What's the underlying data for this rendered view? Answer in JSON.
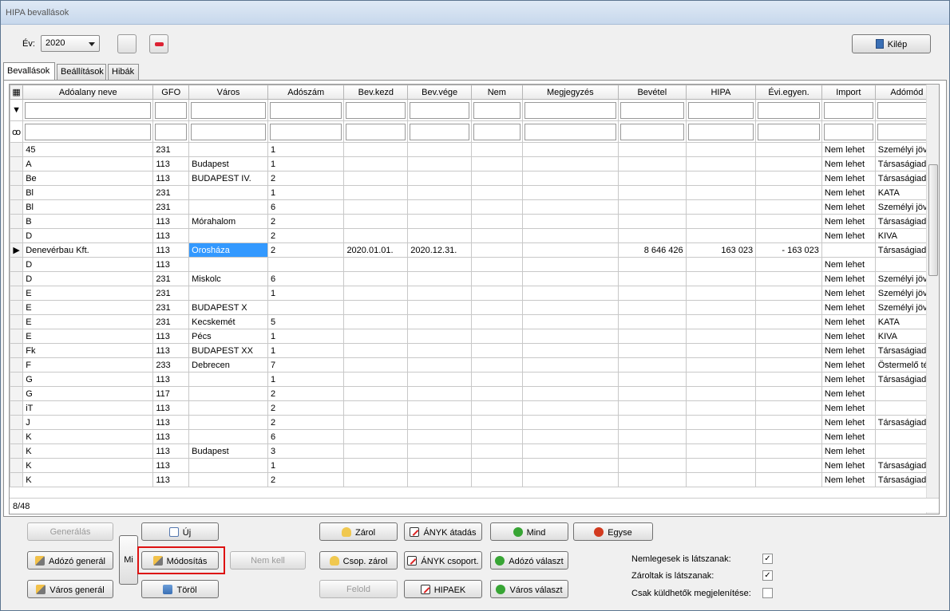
{
  "window": {
    "title": "HIPA bevallások"
  },
  "toolbar": {
    "year_label": "Év:",
    "year_value": "2020",
    "exit_label": "Kilép"
  },
  "tabs": [
    "Bevallások",
    "Beállítások",
    "Hibák"
  ],
  "grid": {
    "columns": [
      "Adóalany neve",
      "GFO",
      "Város",
      "Adószám",
      "Bev.kezd",
      "Bev.vége",
      "Nem",
      "Megjegyzés",
      "Bevétel",
      "HIPA",
      "Évi.egyen.",
      "Import",
      "Adómód"
    ],
    "rows": [
      [
        "45",
        "231",
        "",
        "1",
        "",
        "",
        "",
        "",
        "",
        "",
        "",
        "Nem lehet",
        "Személyi jöve"
      ],
      [
        "A",
        "113",
        "Budapest",
        "1",
        "",
        "",
        "",
        "",
        "",
        "",
        "",
        "Nem lehet",
        "Társaságiadó"
      ],
      [
        "Be",
        "113",
        "BUDAPEST IV.",
        "2",
        "",
        "",
        "",
        "",
        "",
        "",
        "",
        "Nem lehet",
        "Társaságiadó"
      ],
      [
        "Bl",
        "231",
        "",
        "1",
        "",
        "",
        "",
        "",
        "",
        "",
        "",
        "Nem lehet",
        "KATA"
      ],
      [
        "Bl",
        "231",
        "",
        "6",
        "",
        "",
        "",
        "",
        "",
        "",
        "",
        "Nem lehet",
        "Személyi jöve"
      ],
      [
        "B",
        "113",
        "Mórahalom",
        "2",
        "",
        "",
        "",
        "",
        "",
        "",
        "",
        "Nem lehet",
        "Társaságiadó"
      ],
      [
        "D",
        "113",
        "",
        "2",
        "",
        "",
        "",
        "",
        "",
        "",
        "",
        "Nem lehet",
        "KIVA"
      ],
      [
        "Denevérbau Kft.",
        "113",
        "Orosháza",
        "2",
        "2020.01.01.",
        "2020.12.31.",
        "",
        "",
        "8 646 426",
        "163 023",
        "- 163 023",
        "",
        "Társaságiadó"
      ],
      [
        "D",
        "113",
        "",
        "",
        "",
        "",
        "",
        "",
        "",
        "",
        "",
        "Nem lehet",
        ""
      ],
      [
        "D",
        "231",
        "Miskolc",
        "6",
        "",
        "",
        "",
        "",
        "",
        "",
        "",
        "Nem lehet",
        "Személyi jöve"
      ],
      [
        "E",
        "231",
        "",
        "1",
        "",
        "",
        "",
        "",
        "",
        "",
        "",
        "Nem lehet",
        "Személyi jöve"
      ],
      [
        "E",
        "231",
        "BUDAPEST X",
        "",
        "",
        "",
        "",
        "",
        "",
        "",
        "",
        "Nem lehet",
        "Személyi jöve"
      ],
      [
        "E",
        "231",
        "Kecskemét",
        "5",
        "",
        "",
        "",
        "",
        "",
        "",
        "",
        "Nem lehet",
        "KATA"
      ],
      [
        "E",
        "113",
        "Pécs",
        "1",
        "",
        "",
        "",
        "",
        "",
        "",
        "",
        "Nem lehet",
        "KIVA"
      ],
      [
        "Fk",
        "113",
        "BUDAPEST XX",
        "1",
        "",
        "",
        "",
        "",
        "",
        "",
        "",
        "Nem lehet",
        "Társaságiadó"
      ],
      [
        "F",
        "233",
        "Debrecen",
        "7",
        "",
        "",
        "",
        "",
        "",
        "",
        "",
        "Nem lehet",
        "Östermelő téte"
      ],
      [
        "G",
        "113",
        "",
        "1",
        "",
        "",
        "",
        "",
        "",
        "",
        "",
        "Nem lehet",
        "Társaságiadó"
      ],
      [
        "G",
        "117",
        "",
        "2",
        "",
        "",
        "",
        "",
        "",
        "",
        "",
        "Nem lehet",
        ""
      ],
      [
        "iT",
        "113",
        "",
        "2",
        "",
        "",
        "",
        "",
        "",
        "",
        "",
        "Nem lehet",
        ""
      ],
      [
        "J",
        "113",
        "",
        "2",
        "",
        "",
        "",
        "",
        "",
        "",
        "",
        "Nem lehet",
        "Társaságiadó"
      ],
      [
        "K",
        "113",
        "",
        "6",
        "",
        "",
        "",
        "",
        "",
        "",
        "",
        "Nem lehet",
        ""
      ],
      [
        "K",
        "113",
        "Budapest",
        "3",
        "",
        "",
        "",
        "",
        "",
        "",
        "",
        "Nem lehet",
        ""
      ],
      [
        "K",
        "113",
        "",
        "1",
        "",
        "",
        "",
        "",
        "",
        "",
        "",
        "Nem lehet",
        "Társaságiadó"
      ],
      [
        "K",
        "113",
        "",
        "2",
        "",
        "",
        "",
        "",
        "",
        "",
        "",
        "Nem lehet",
        "Társaságiadó"
      ]
    ],
    "status": "8/48"
  },
  "buttons": {
    "generalas": "Generálás",
    "adozo_general": "Adózó generál",
    "varos_general": "Város generál",
    "side": "Mi",
    "uj": "Új",
    "modositas": "Módosítás",
    "torol": "Töröl",
    "nem_kell": "Nem kell",
    "zarol": "Zárol",
    "csop_zarol": "Csop. zárol",
    "felold": "Felold",
    "anyk_atadas": "ÁNYK átadás",
    "anyk_csoport": "ÁNYK csoport.",
    "hipaek": "HIPAEK",
    "mind": "Mind",
    "adozo_valaszt": "Adózó választ",
    "varos_valaszt": "Város választ",
    "egyse": "Egyse"
  },
  "options": {
    "nemlegesek": "Nemlegesek is látszanak:",
    "zaroltak": "Zároltak is látszanak:",
    "csak_kuldhetok": "Csak küldhetők megjelenítése:"
  }
}
